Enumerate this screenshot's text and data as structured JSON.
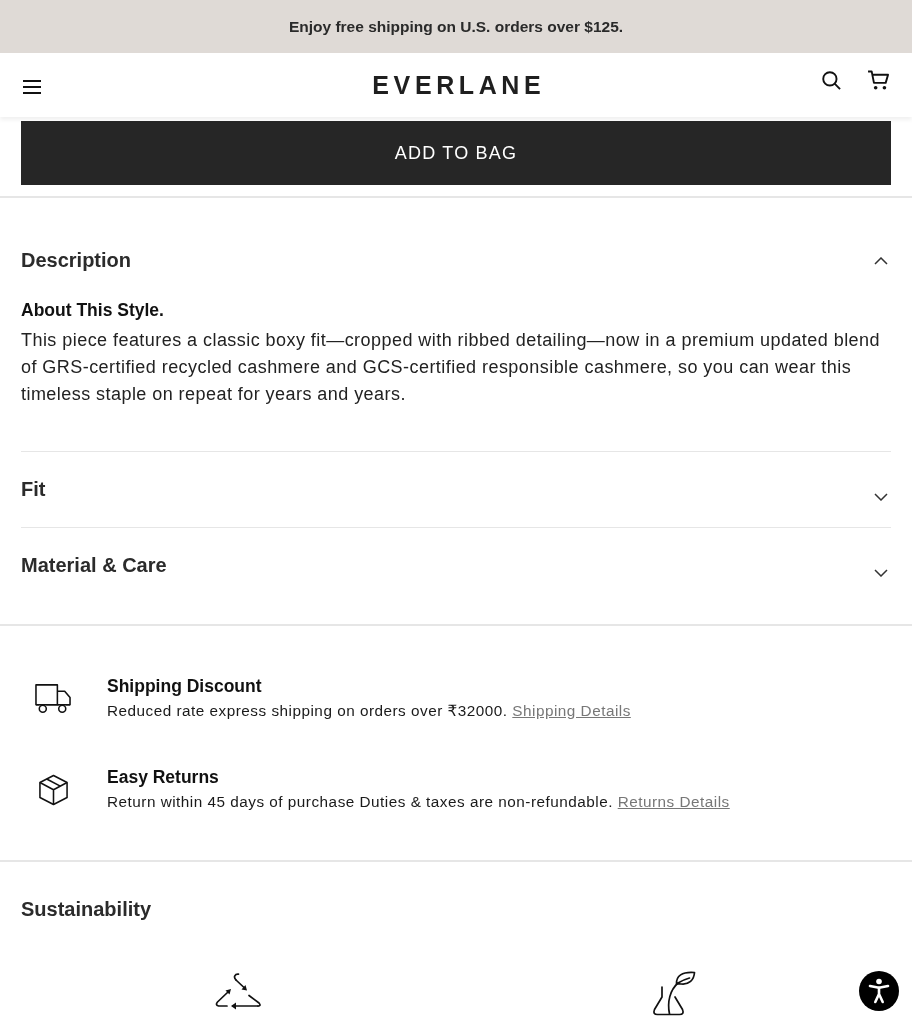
{
  "announcement": {
    "text": "Enjoy free shipping on U.S. orders over $125."
  },
  "header": {
    "logo": "EVERLANE"
  },
  "add_to_bag": {
    "label": "ADD TO BAG"
  },
  "accordion": [
    {
      "title": "Description",
      "expanded": true,
      "subtitle": "About This Style.",
      "body": "This piece features a classic boxy fit—cropped with ribbed detailing—now in a premium updated blend of GRS-certified recycled cashmere and GCS-certified responsible cashmere, so you can wear this timeless staple on repeat for years and years."
    },
    {
      "title": "Fit",
      "expanded": false
    },
    {
      "title": "Material & Care",
      "expanded": false
    }
  ],
  "perks": [
    {
      "kind": "shipping",
      "title": "Shipping Discount",
      "text": "Reduced rate express shipping on orders over ₹32000.",
      "link": "Shipping Details"
    },
    {
      "kind": "returns",
      "title": "Easy Returns",
      "text": "Return within 45 days of purchase Duties & taxes are non-refundable.",
      "link": "Returns Details"
    }
  ],
  "sustainability": {
    "title": "Sustainability",
    "items": [
      {
        "kind": "recycled"
      },
      {
        "kind": "plant"
      }
    ]
  }
}
